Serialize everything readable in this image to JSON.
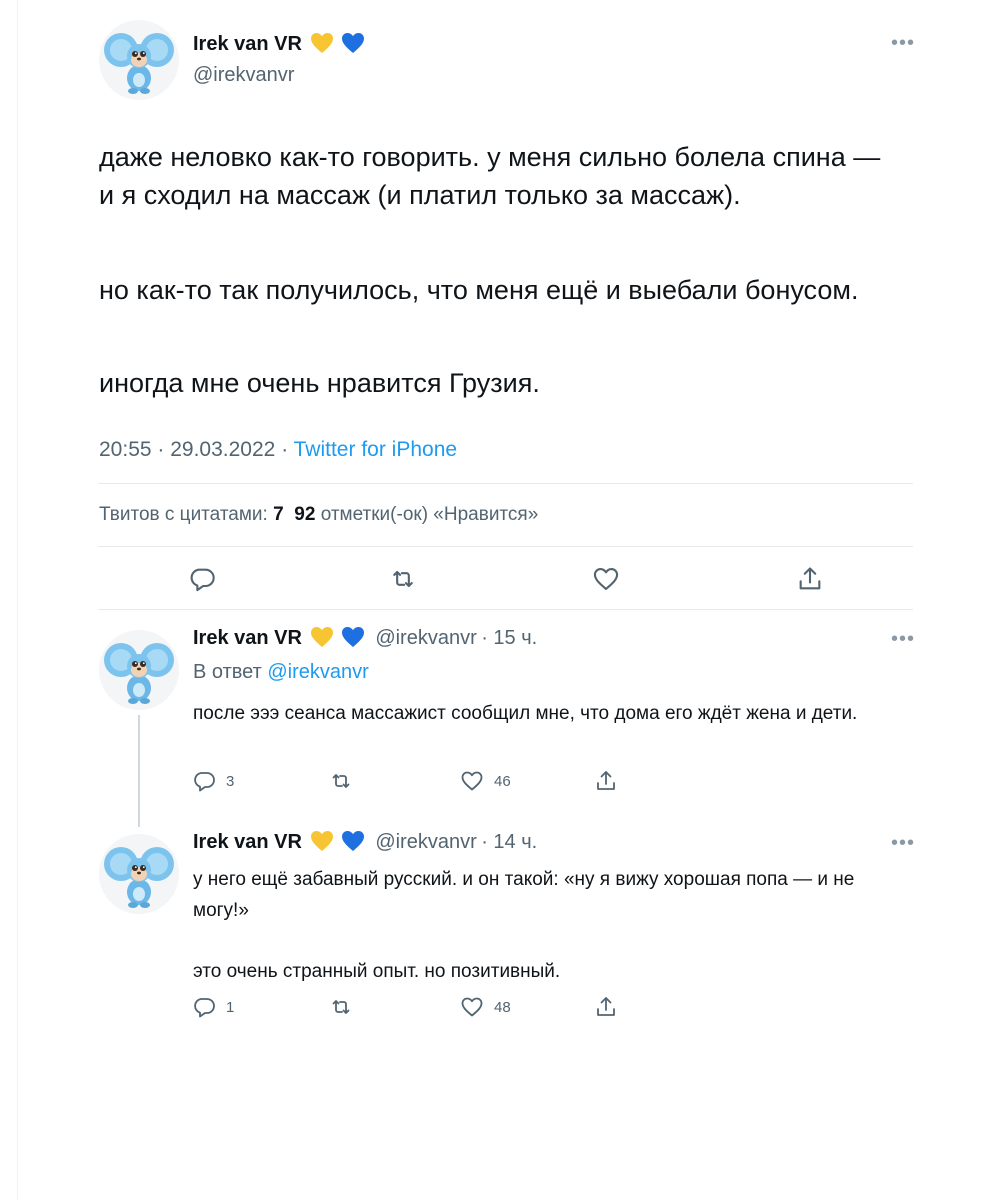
{
  "main_tweet": {
    "author_name": "Irek van VR",
    "handle": "@irekvanvr",
    "text": {
      "p1": "даже неловко как-то говорить. у меня сильно болела спина — и я сходил на массаж (и платил только за массаж).",
      "p2": "но как-то так получилось, что меня ещё и выебали бонусом.",
      "p3": "иногда мне очень нравится Грузия."
    },
    "time": "20:55",
    "date": "29.03.2022",
    "client": "Twitter for iPhone",
    "stats": {
      "quotes_label": "Твитов с цитатами:",
      "quotes_count": "7",
      "likes_count": "92",
      "likes_label": "отметки(-ок) «Нравится»"
    }
  },
  "replies": [
    {
      "author_name": "Irek van VR",
      "handle": "@irekvanvr",
      "time": "15 ч.",
      "reply_to_label": "В ответ",
      "reply_to_handle": "@irekvanvr",
      "text": "после эээ сеанса массажист сообщил мне, что дома его ждёт жена и дети.",
      "reply_count": "3",
      "retweet_count": "",
      "like_count": "46"
    },
    {
      "author_name": "Irek van VR",
      "handle": "@irekvanvr",
      "time": "14 ч.",
      "text_line1": "у него ещё забавный русский. и он такой: «ну я вижу хорошая попа — и не могу!»",
      "text_line2": "это очень странный опыт. но позитивный.",
      "reply_count": "1",
      "retweet_count": "",
      "like_count": "48"
    }
  ],
  "icons": {
    "more": "more-horizontal-icon",
    "reply": "reply-icon",
    "retweet": "retweet-icon",
    "like": "heart-icon",
    "share": "share-icon",
    "yellow_heart": "yellow-heart-emoji",
    "blue_heart": "blue-heart-emoji"
  },
  "colors": {
    "link": "#1d9bf0",
    "text": "#0f1419",
    "secondary": "#536471",
    "divider": "#e7eaec",
    "yellow_heart": "#f7c531",
    "blue_heart": "#1e6fe0"
  }
}
